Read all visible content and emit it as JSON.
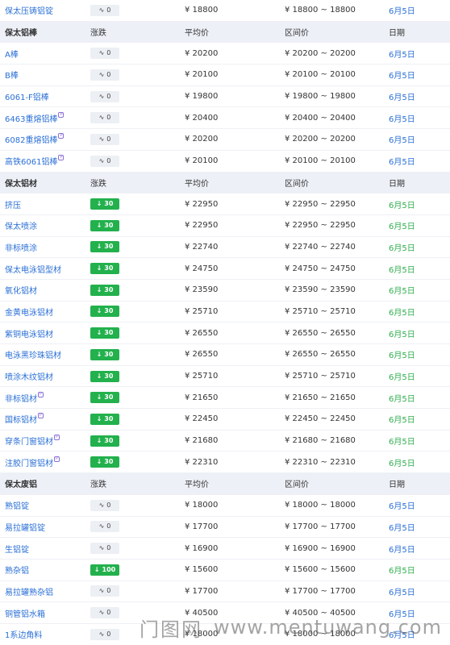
{
  "sections": [
    {
      "rows": [
        {
          "name": "保太压铸铝锭",
          "change": "0",
          "dir": "flat",
          "avg": "¥ 18800",
          "range": "¥ 18800 ~ 18800",
          "date": "6月5日",
          "date_color": "blue"
        }
      ]
    },
    {
      "header": {
        "name": "保太铝棒",
        "change": "涨跌",
        "avg": "平均价",
        "range": "区间价",
        "date": "日期"
      },
      "rows": [
        {
          "name": "A棒",
          "change": "0",
          "dir": "flat",
          "avg": "¥ 20200",
          "range": "¥ 20200 ~ 20200",
          "date": "6月5日",
          "date_color": "blue"
        },
        {
          "name": "B棒",
          "change": "0",
          "dir": "flat",
          "avg": "¥ 20100",
          "range": "¥ 20100 ~ 20100",
          "date": "6月5日",
          "date_color": "blue"
        },
        {
          "name": "6061-F铝棒",
          "change": "0",
          "dir": "flat",
          "avg": "¥ 19800",
          "range": "¥ 19800 ~ 19800",
          "date": "6月5日",
          "date_color": "blue"
        },
        {
          "name": "6463重熔铝棒",
          "change": "0",
          "dir": "flat",
          "avg": "¥ 20400",
          "range": "¥ 20400 ~ 20400",
          "date": "6月5日",
          "date_color": "blue",
          "tag": "P"
        },
        {
          "name": "6082重熔铝棒",
          "change": "0",
          "dir": "flat",
          "avg": "¥ 20200",
          "range": "¥ 20200 ~ 20200",
          "date": "6月5日",
          "date_color": "blue",
          "tag": "P"
        },
        {
          "name": "高铁6061铝棒",
          "change": "0",
          "dir": "flat",
          "avg": "¥ 20100",
          "range": "¥ 20100 ~ 20100",
          "date": "6月5日",
          "date_color": "blue",
          "tag": "P"
        }
      ]
    },
    {
      "header": {
        "name": "保太铝材",
        "change": "涨跌",
        "avg": "平均价",
        "range": "区间价",
        "date": "日期"
      },
      "rows": [
        {
          "name": "挤压",
          "change": "30",
          "dir": "down",
          "avg": "¥ 22950",
          "range": "¥ 22950 ~ 22950",
          "date": "6月5日",
          "date_color": "green"
        },
        {
          "name": "保太喷涂",
          "change": "30",
          "dir": "down",
          "avg": "¥ 22950",
          "range": "¥ 22950 ~ 22950",
          "date": "6月5日",
          "date_color": "green"
        },
        {
          "name": "非标喷涂",
          "change": "30",
          "dir": "down",
          "avg": "¥ 22740",
          "range": "¥ 22740 ~ 22740",
          "date": "6月5日",
          "date_color": "green"
        },
        {
          "name": "保太电泳铝型材",
          "change": "30",
          "dir": "down",
          "avg": "¥ 24750",
          "range": "¥ 24750 ~ 24750",
          "date": "6月5日",
          "date_color": "green"
        },
        {
          "name": "氧化铝材",
          "change": "30",
          "dir": "down",
          "avg": "¥ 23590",
          "range": "¥ 23590 ~ 23590",
          "date": "6月5日",
          "date_color": "green"
        },
        {
          "name": "金黄电泳铝材",
          "change": "30",
          "dir": "down",
          "avg": "¥ 25710",
          "range": "¥ 25710 ~ 25710",
          "date": "6月5日",
          "date_color": "green"
        },
        {
          "name": "紫铜电泳铝材",
          "change": "30",
          "dir": "down",
          "avg": "¥ 26550",
          "range": "¥ 26550 ~ 26550",
          "date": "6月5日",
          "date_color": "green"
        },
        {
          "name": "电泳黑珍珠铝材",
          "change": "30",
          "dir": "down",
          "avg": "¥ 26550",
          "range": "¥ 26550 ~ 26550",
          "date": "6月5日",
          "date_color": "green"
        },
        {
          "name": "喷涂木纹铝材",
          "change": "30",
          "dir": "down",
          "avg": "¥ 25710",
          "range": "¥ 25710 ~ 25710",
          "date": "6月5日",
          "date_color": "green"
        },
        {
          "name": "非标铝材",
          "change": "30",
          "dir": "down",
          "avg": "¥ 21650",
          "range": "¥ 21650 ~ 21650",
          "date": "6月5日",
          "date_color": "green",
          "tag": "P"
        },
        {
          "name": "国标铝材",
          "change": "30",
          "dir": "down",
          "avg": "¥ 22450",
          "range": "¥ 22450 ~ 22450",
          "date": "6月5日",
          "date_color": "green",
          "tag": "P"
        },
        {
          "name": "穿条门窗铝材",
          "change": "30",
          "dir": "down",
          "avg": "¥ 21680",
          "range": "¥ 21680 ~ 21680",
          "date": "6月5日",
          "date_color": "green",
          "tag": "P"
        },
        {
          "name": "注胶门窗铝材",
          "change": "30",
          "dir": "down",
          "avg": "¥ 22310",
          "range": "¥ 22310 ~ 22310",
          "date": "6月5日",
          "date_color": "green",
          "tag": "P"
        }
      ]
    },
    {
      "header": {
        "name": "保太废铝",
        "change": "涨跌",
        "avg": "平均价",
        "range": "区间价",
        "date": "日期"
      },
      "rows": [
        {
          "name": "熟铝锭",
          "change": "0",
          "dir": "flat",
          "avg": "¥ 18000",
          "range": "¥ 18000 ~ 18000",
          "date": "6月5日",
          "date_color": "blue"
        },
        {
          "name": "易拉罐铝锭",
          "change": "0",
          "dir": "flat",
          "avg": "¥ 17700",
          "range": "¥ 17700 ~ 17700",
          "date": "6月5日",
          "date_color": "blue"
        },
        {
          "name": "生铝锭",
          "change": "0",
          "dir": "flat",
          "avg": "¥ 16900",
          "range": "¥ 16900 ~ 16900",
          "date": "6月5日",
          "date_color": "blue"
        },
        {
          "name": "熟杂铝",
          "change": "100",
          "dir": "down",
          "avg": "¥ 15600",
          "range": "¥ 15600 ~ 15600",
          "date": "6月5日",
          "date_color": "green"
        },
        {
          "name": "易拉罐熟杂铝",
          "change": "0",
          "dir": "flat",
          "avg": "¥ 17700",
          "range": "¥ 17700 ~ 17700",
          "date": "6月5日",
          "date_color": "blue"
        },
        {
          "name": "铜管铝水箱",
          "change": "0",
          "dir": "flat",
          "avg": "¥ 40500",
          "range": "¥ 40500 ~ 40500",
          "date": "6月5日",
          "date_color": "blue"
        },
        {
          "name": "1系边角料",
          "change": "0",
          "dir": "flat",
          "avg": "¥ 18000",
          "range": "¥ 18000 ~ 18000",
          "date": "6月5日",
          "date_color": "blue"
        }
      ]
    }
  ],
  "icons": {
    "flat": "tilde-icon",
    "down": "arrow-down-icon"
  },
  "colors": {
    "link": "#2a6fd6",
    "green": "#2fae4e",
    "badge_green": "#23b14d",
    "header_bg": "#eef0f8"
  },
  "watermark": {
    "cn": "门图网",
    "en": "www.mentuwang.com"
  }
}
